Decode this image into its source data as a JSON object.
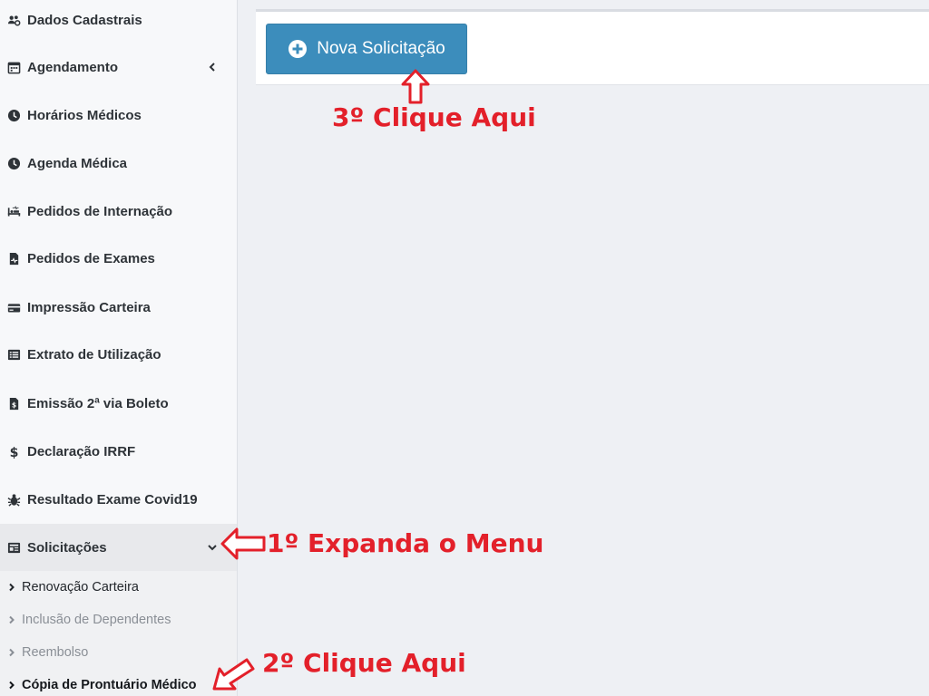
{
  "sidebar": {
    "items": [
      {
        "label": "Dados Cadastrais",
        "icon": "users-cog-icon"
      },
      {
        "label": "Agendamento",
        "icon": "calendar-icon"
      },
      {
        "label": "Horários Médicos",
        "icon": "clock-icon"
      },
      {
        "label": "Agenda Médica",
        "icon": "clock-icon"
      },
      {
        "label": "Pedidos de Internação",
        "icon": "procedures-bed-icon"
      },
      {
        "label": "Pedidos de Exames",
        "icon": "file-medical-icon"
      },
      {
        "label": "Impressão Carteira",
        "icon": "credit-card-icon"
      },
      {
        "label": "Extrato de Utilização",
        "icon": "list-alt-icon"
      },
      {
        "label": "Emissão 2ª via Boleto",
        "icon": "file-invoice-dollar-icon"
      },
      {
        "label": "Declaração IRRF",
        "icon": "dollar-sign-icon"
      },
      {
        "label": "Resultado Exame Covid19",
        "icon": "virus-bug-icon"
      },
      {
        "label": "Solicitações",
        "icon": "newspaper-icon"
      }
    ],
    "subitems": [
      {
        "label": "Renovação Carteira"
      },
      {
        "label": "Inclusão de Dependentes"
      },
      {
        "label": "Reembolso"
      },
      {
        "label": "Cópia de Prontuário Médico"
      }
    ]
  },
  "main": {
    "new_request_label": "Nova Solicitação"
  },
  "annotations": {
    "step1": "1º Expanda o Menu",
    "step2": "2º Clique Aqui",
    "step3": "3º Clique Aqui",
    "color": "#e3202a"
  },
  "colors": {
    "primary_button": "#3c8dbc",
    "sidebar_bg": "#f7f8fa",
    "content_bg": "#eef0f4"
  }
}
